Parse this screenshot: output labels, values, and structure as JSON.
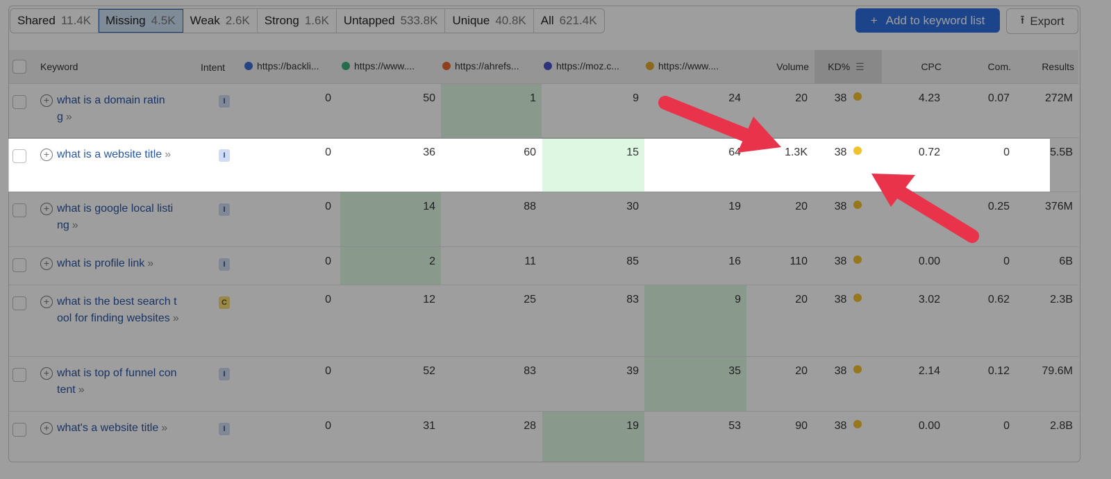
{
  "tabs": [
    {
      "label": "Shared",
      "count": "11.4K",
      "active": false
    },
    {
      "label": "Missing",
      "count": "4.5K",
      "active": true
    },
    {
      "label": "Weak",
      "count": "2.6K",
      "active": false
    },
    {
      "label": "Strong",
      "count": "1.6K",
      "active": false
    },
    {
      "label": "Untapped",
      "count": "533.8K",
      "active": false
    },
    {
      "label": "Unique",
      "count": "40.8K",
      "active": false
    },
    {
      "label": "All",
      "count": "621.4K",
      "active": false
    }
  ],
  "toolbar": {
    "add_label": "Add to keyword list",
    "export_label": "Export",
    "add_icon": "plus-icon",
    "export_icon": "upload-icon"
  },
  "colors": {
    "accent": "#2e6ee0",
    "arrow": "#e8334a",
    "highlight_cell": "#ddf7e2",
    "kd_dot": "#f2c12e"
  },
  "columns": {
    "keyword": "Keyword",
    "intent": "Intent",
    "domains": [
      {
        "label": "https://backli...",
        "color": "#3d6fd6"
      },
      {
        "label": "https://www....",
        "color": "#3fb07a"
      },
      {
        "label": "https://ahrefs...",
        "color": "#e5692e"
      },
      {
        "label": "https://moz.c...",
        "color": "#4b55c8"
      },
      {
        "label": "https://www....",
        "color": "#e0a92c"
      }
    ],
    "volume": "Volume",
    "kd": "KD%",
    "cpc": "CPC",
    "com": "Com.",
    "results": "Results"
  },
  "rows": [
    {
      "keyword": "what is a domain rating",
      "intent": "I",
      "values": [
        "0",
        "50",
        "1",
        "9",
        "24"
      ],
      "volume": "20",
      "kd": "38",
      "cpc": "4.23",
      "com": "0.07",
      "results": "272M"
    },
    {
      "keyword": "what is a website title",
      "intent": "I",
      "values": [
        "0",
        "36",
        "60",
        "15",
        "64"
      ],
      "volume": "1.3K",
      "kd": "38",
      "cpc": "0.72",
      "com": "0",
      "results": "5.5B"
    },
    {
      "keyword": "what is google local listing",
      "intent": "I",
      "values": [
        "0",
        "14",
        "88",
        "30",
        "19"
      ],
      "volume": "20",
      "kd": "38",
      "cpc": "",
      "com": "0.25",
      "results": "376M"
    },
    {
      "keyword": "what is profile link",
      "intent": "I",
      "values": [
        "0",
        "2",
        "11",
        "85",
        "16"
      ],
      "volume": "110",
      "kd": "38",
      "cpc": "0.00",
      "com": "0",
      "results": "6B"
    },
    {
      "keyword": "what is the best search tool for finding websites",
      "intent": "C",
      "values": [
        "0",
        "12",
        "25",
        "83",
        "9"
      ],
      "volume": "20",
      "kd": "38",
      "cpc": "3.02",
      "com": "0.62",
      "results": "2.3B"
    },
    {
      "keyword": "what is top of funnel content",
      "intent": "I",
      "values": [
        "0",
        "52",
        "83",
        "39",
        "35"
      ],
      "volume": "20",
      "kd": "38",
      "cpc": "2.14",
      "com": "0.12",
      "results": "79.6M"
    },
    {
      "keyword": "what's a website title",
      "intent": "I",
      "values": [
        "0",
        "31",
        "28",
        "19",
        "53"
      ],
      "volume": "90",
      "kd": "38",
      "cpc": "0.00",
      "com": "0",
      "results": "2.8B"
    }
  ]
}
